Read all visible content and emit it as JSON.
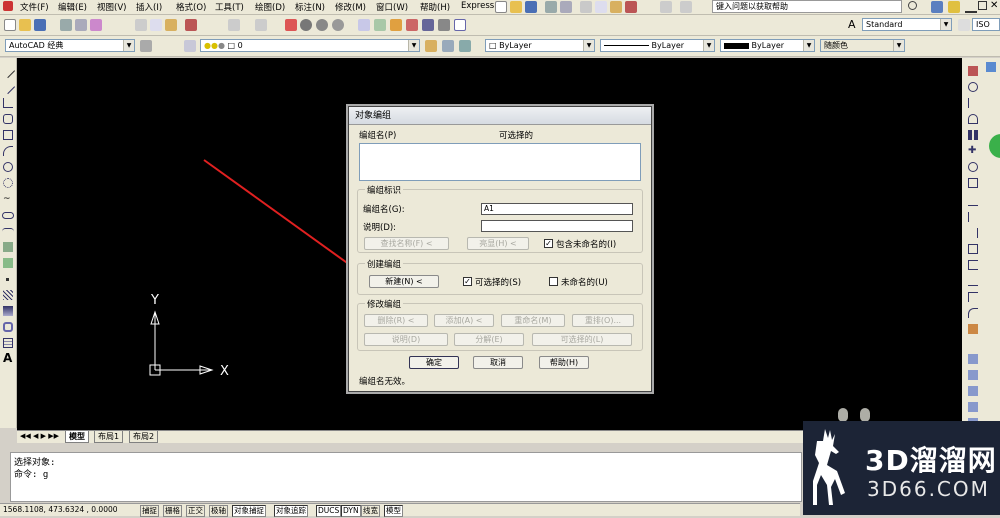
{
  "menu": {
    "items": [
      "文件(F)",
      "编辑(E)",
      "视图(V)",
      "插入(I)",
      "格式(O)",
      "工具(T)",
      "绘图(D)",
      "标注(N)",
      "修改(M)",
      "窗口(W)",
      "帮助(H)",
      "Express"
    ],
    "help_search_placeholder": "键入问题以获取帮助"
  },
  "toolbar": {
    "workspace": "AutoCAD 经典",
    "layer_value": "0",
    "text_style": "Standard",
    "dim_style": "ISO",
    "color": "ByLayer",
    "linetype": "ByLayer",
    "lineweight": "ByLayer",
    "plot_style": "随颜色"
  },
  "canvas": {
    "ucs_x_label": "X",
    "ucs_y_label": "Y"
  },
  "layout_tabs": [
    "模型",
    "布局1",
    "布局2"
  ],
  "command": {
    "line1": "选择对象:",
    "line2": "命令: g"
  },
  "status": {
    "coords": "1568.1108, 473.6324 , 0.0000",
    "buttons": [
      "捕捉",
      "栅格",
      "正交",
      "极轴",
      "对象捕捉",
      "对象追踪",
      "DUCS",
      "DYN",
      "线宽",
      "模型"
    ]
  },
  "dialog": {
    "title": "对象编组",
    "list_header_name": "编组名(P)",
    "list_header_selectable": "可选择的",
    "identification": {
      "title": "编组标识",
      "name_label": "编组名(G):",
      "name_value": "A1",
      "desc_label": "说明(D):",
      "desc_value": "",
      "find_btn": "查找名称(F) <",
      "highlight_btn": "亮显(H) <",
      "include_unnamed_label": "包含未命名的(I)",
      "include_unnamed_checked": true
    },
    "create": {
      "title": "创建编组",
      "new_btn": "新建(N) <",
      "selectable_label": "可选择的(S)",
      "selectable_checked": true,
      "unnamed_label": "未命名的(U)",
      "unnamed_checked": false
    },
    "modify": {
      "title": "修改编组",
      "remove_btn": "删除(R) <",
      "add_btn": "添加(A) <",
      "rename_btn": "重命名(M)",
      "reorder_btn": "重排(O)...",
      "description_btn": "说明(D)",
      "explode_btn": "分解(E)",
      "selectable_btn": "可选择的(L)"
    },
    "ok_btn": "确定",
    "cancel_btn": "取消",
    "help_btn": "帮助(H)",
    "message": "编组名无效。"
  },
  "watermark": {
    "brand_text": "3D溜溜网",
    "url_text": "3D66.COM"
  },
  "colors": {
    "canvas_bg": "#000000",
    "annotation_arrow": "#e02020",
    "ui_bg": "#ece9d8",
    "watermark_bg": "#1c2436"
  }
}
